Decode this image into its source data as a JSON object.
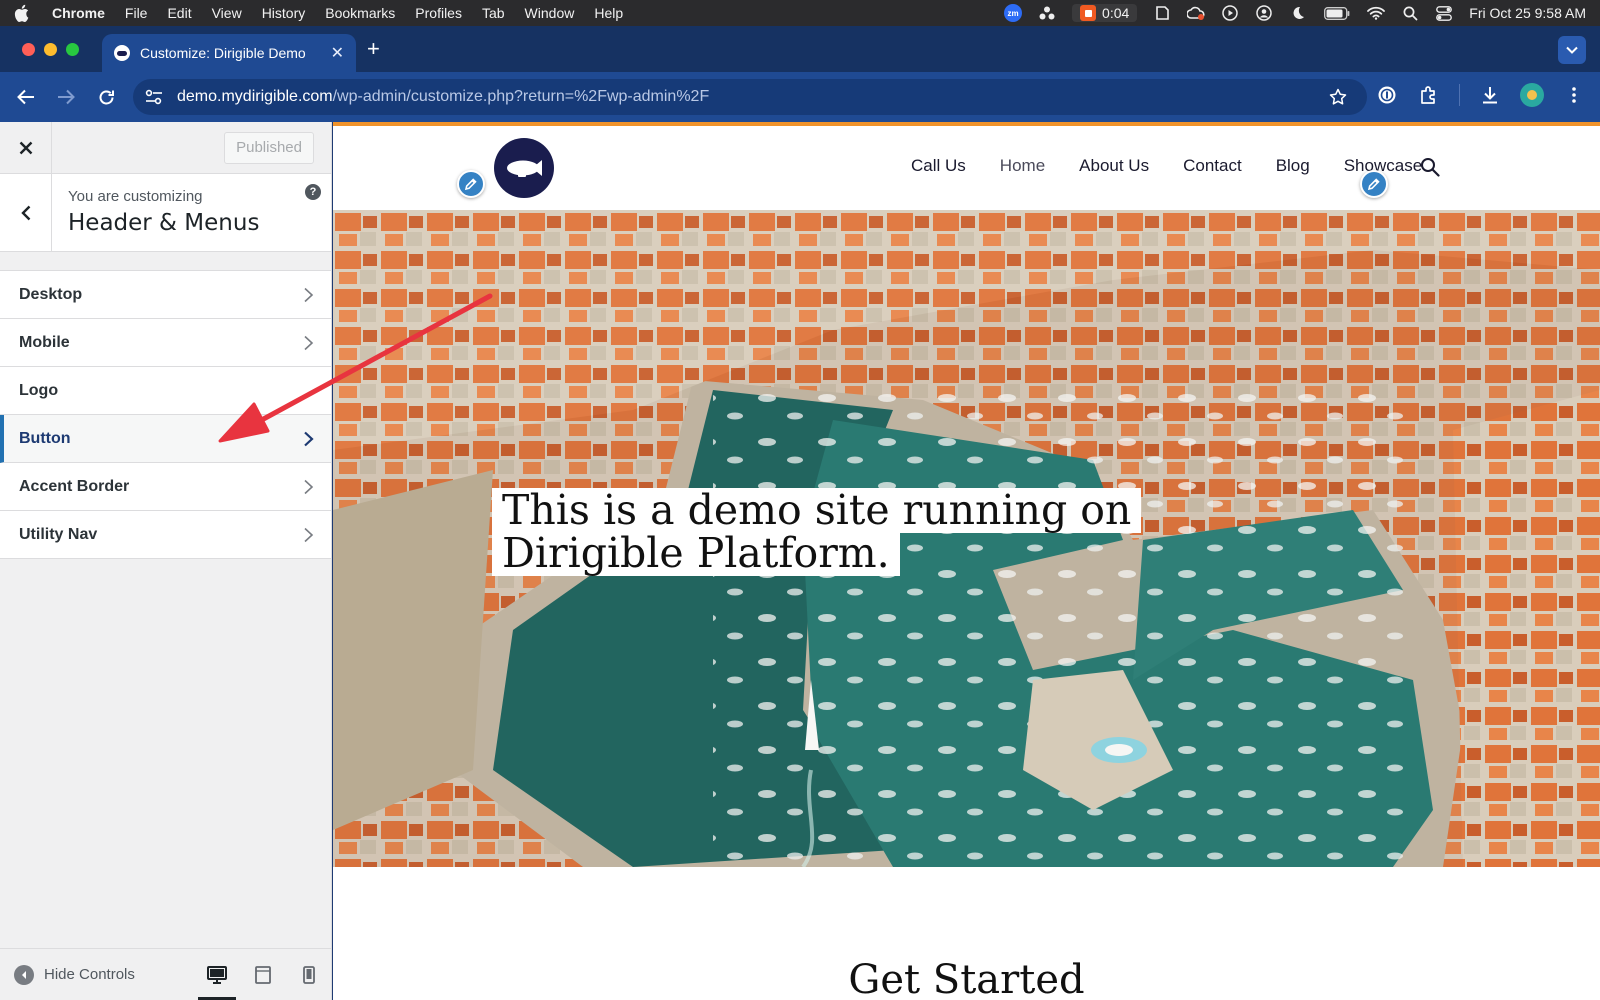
{
  "menubar": {
    "app_name": "Chrome",
    "items": [
      "File",
      "Edit",
      "View",
      "History",
      "Bookmarks",
      "Profiles",
      "Tab",
      "Window",
      "Help"
    ],
    "zoom_badge": "zm",
    "recording_time": "0:04",
    "datetime": "Fri Oct 25  9:58 AM"
  },
  "browser": {
    "tab_title": "Customize: Dirigible Demo",
    "url_host": "demo.mydirigible.com",
    "url_path": "/wp-admin/customize.php?return=%2Fwp-admin%2F"
  },
  "customizer": {
    "publish_label": "Published",
    "pre_title": "You are customizing",
    "section_title": "Header & Menus",
    "help_glyph": "?",
    "items": [
      {
        "label": "Desktop",
        "has_chevron": true
      },
      {
        "label": "Mobile",
        "has_chevron": true
      },
      {
        "label": "Logo",
        "has_chevron": false
      },
      {
        "label": "Button",
        "has_chevron": true
      },
      {
        "label": "Accent Border",
        "has_chevron": true
      },
      {
        "label": "Utility Nav",
        "has_chevron": true
      }
    ],
    "active_item": "Button",
    "hide_controls_label": "Hide Controls",
    "active_device": "desktop"
  },
  "site": {
    "nav": [
      "Call Us",
      "Home",
      "About Us",
      "Contact",
      "Blog",
      "Showcase"
    ],
    "current_nav": "Home",
    "hero_line1": "This is a demo site running on",
    "hero_line2": "Dirigible Platform.",
    "section_heading": "Get Started"
  },
  "colors": {
    "accent_border": "#f0932b",
    "logo_bg": "#1a1d4e",
    "active_item_bar": "#2271b1",
    "annotation_arrow": "#e8343f"
  }
}
